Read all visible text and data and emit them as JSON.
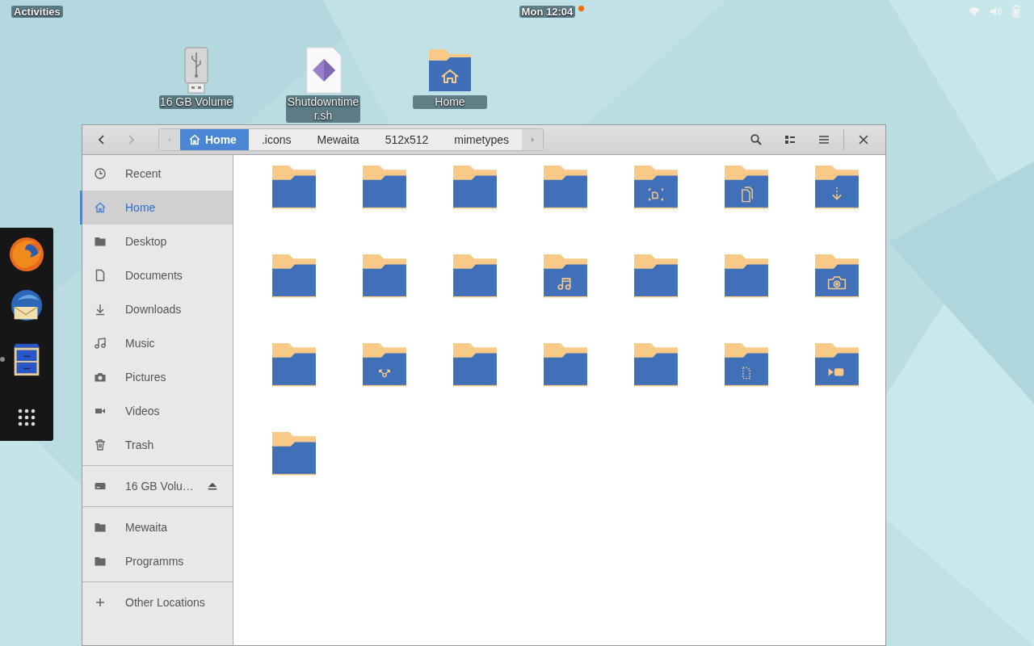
{
  "top_bar": {
    "activities": "Activities",
    "clock": "Mon 12:04",
    "notification": true
  },
  "desktop_icons": [
    {
      "kind": "usb",
      "label": "16 GB Volume"
    },
    {
      "kind": "script",
      "label": "Shutdowntimer.sh"
    },
    {
      "kind": "home",
      "label": "Home"
    }
  ],
  "dock": [
    {
      "kind": "browser",
      "running": false
    },
    {
      "kind": "mail",
      "running": false
    },
    {
      "kind": "files",
      "running": true
    },
    {
      "kind": "apps",
      "running": false
    }
  ],
  "window": {
    "back_disabled": false,
    "forward_disabled": true,
    "path": [
      {
        "label": "Home",
        "kind": "home",
        "selected": true
      },
      {
        "label": ".icons",
        "kind": "folder",
        "selected": false
      },
      {
        "label": "Mewaita",
        "kind": "folder",
        "selected": false
      },
      {
        "label": "512x512",
        "kind": "folder",
        "selected": false
      },
      {
        "label": "mimetypes",
        "kind": "folder",
        "selected": false
      }
    ],
    "sidebar": [
      [
        {
          "kind": "recent",
          "label": "Recent",
          "selected": false
        },
        {
          "kind": "home",
          "label": "Home",
          "selected": true
        },
        {
          "kind": "folder",
          "label": "Desktop",
          "selected": false
        },
        {
          "kind": "document",
          "label": "Documents",
          "selected": false
        },
        {
          "kind": "download",
          "label": "Downloads",
          "selected": false
        },
        {
          "kind": "music",
          "label": "Music",
          "selected": false
        },
        {
          "kind": "camera",
          "label": "Pictures",
          "selected": false
        },
        {
          "kind": "video",
          "label": "Videos",
          "selected": false
        },
        {
          "kind": "trash",
          "label": "Trash",
          "selected": false
        }
      ],
      [
        {
          "kind": "drive",
          "label": "16 GB Volu…",
          "selected": false,
          "eject": true
        }
      ],
      [
        {
          "kind": "folder",
          "label": "Mewaita",
          "selected": false
        },
        {
          "kind": "folder",
          "label": "Programms",
          "selected": false
        }
      ],
      [
        {
          "kind": "plus",
          "label": "Other Locations",
          "selected": false
        }
      ]
    ],
    "folders": [
      {
        "kind": "plain"
      },
      {
        "kind": "plain"
      },
      {
        "kind": "plain"
      },
      {
        "kind": "plain"
      },
      {
        "kind": "screenshot"
      },
      {
        "kind": "documents"
      },
      {
        "kind": "download"
      },
      {
        "kind": "plain"
      },
      {
        "kind": "plain"
      },
      {
        "kind": "plain"
      },
      {
        "kind": "music"
      },
      {
        "kind": "plain"
      },
      {
        "kind": "plain"
      },
      {
        "kind": "camera"
      },
      {
        "kind": "plain"
      },
      {
        "kind": "share"
      },
      {
        "kind": "plain"
      },
      {
        "kind": "plain"
      },
      {
        "kind": "plain"
      },
      {
        "kind": "template"
      },
      {
        "kind": "video"
      },
      {
        "kind": "plain"
      }
    ]
  }
}
